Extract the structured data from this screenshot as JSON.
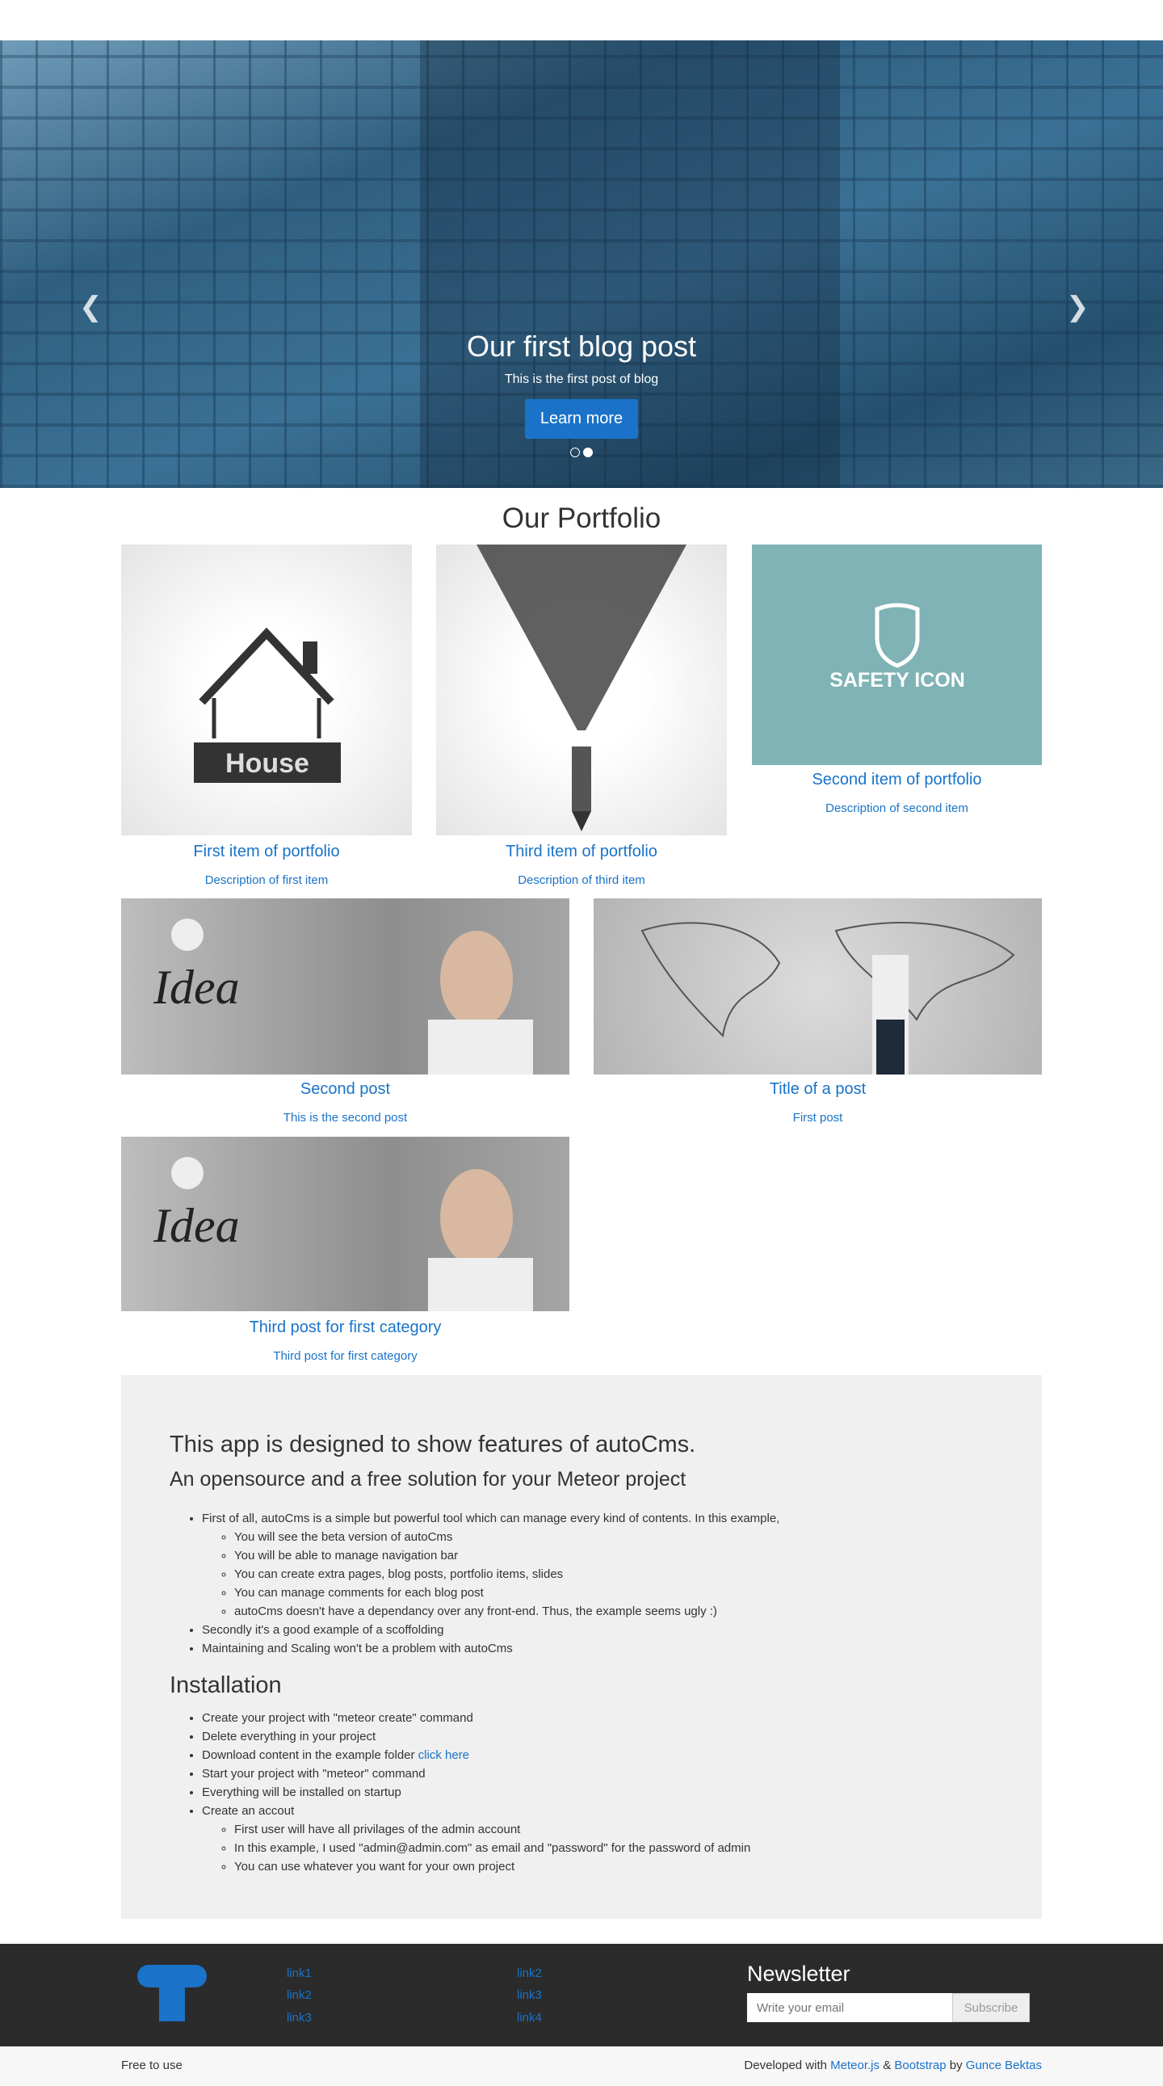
{
  "hero": {
    "title": "Our first blog post",
    "subtitle": "This is the first post of blog",
    "button": "Learn more",
    "active_slide": 2,
    "slide_count": 2
  },
  "portfolio": {
    "title": "Our Portfolio",
    "items": [
      {
        "title": "First item of portfolio",
        "desc": "Description of first item",
        "image_text": "House"
      },
      {
        "title": "Third item of portfolio",
        "desc": "Description of third item"
      },
      {
        "title": "Second item of portfolio",
        "desc": "Description of second item",
        "image_text": "SAFETY ICON"
      },
      {
        "title": "Second post",
        "desc": "This is the second post",
        "image_text": "Idea"
      },
      {
        "title": "Title of a post",
        "desc": "First post"
      },
      {
        "title": "Third post for first category",
        "desc": "Third post for first category",
        "image_text": "Idea"
      }
    ]
  },
  "info": {
    "heading": "This app is designed to show features of autoCms.",
    "subheading": "An opensource and a free solution for your Meteor project",
    "features": {
      "first": "First of all, autoCms is a simple but powerful tool which can manage every kind of contents. In this example,",
      "sub": [
        "You will see the beta version of autoCms",
        "You will be able to manage navigation bar",
        "You can create extra pages, blog posts, portfolio items, slides",
        "You can manage comments for each blog post",
        "autoCms doesn't have a dependancy over any front-end. Thus, the example seems ugly :)"
      ],
      "second": "Secondly it's a good example of a scoffolding",
      "third": "Maintaining and Scaling won't be a problem with autoCms"
    },
    "install_heading": "Installation",
    "install": {
      "steps": [
        "Create your project with \"meteor create\" command",
        "Delete everything in your project"
      ],
      "download": "Download content in the example folder",
      "download_link": "click here",
      "steps2": [
        "Start your project with \"meteor\" command",
        "Everything will be installed on startup",
        "Create an accout"
      ],
      "sub": [
        "First user will have all privilages of the admin account",
        "In this example, I used \"admin@admin.com\" as email and \"password\" for the password of admin",
        "You can use whatever you want for your own project"
      ]
    }
  },
  "footer": {
    "links_col1": [
      "link1",
      "link2",
      "link3"
    ],
    "links_col2": [
      "link2",
      "link3",
      "link4"
    ],
    "newsletter_title": "Newsletter",
    "email_placeholder": "Write your email",
    "subscribe": "Subscribe"
  },
  "bottom": {
    "left": "Free to use",
    "dev_prefix": "Developed with",
    "meteor": "Meteor.js",
    "amp": "&",
    "bootstrap": "Bootstrap",
    "by": "by",
    "author": "Gunce Bektas"
  },
  "colors": {
    "accent": "#1a73c8",
    "footer_bg": "#2b2b2b",
    "info_bg": "#f0f0f0",
    "safety_bg": "#7fb3b5"
  }
}
